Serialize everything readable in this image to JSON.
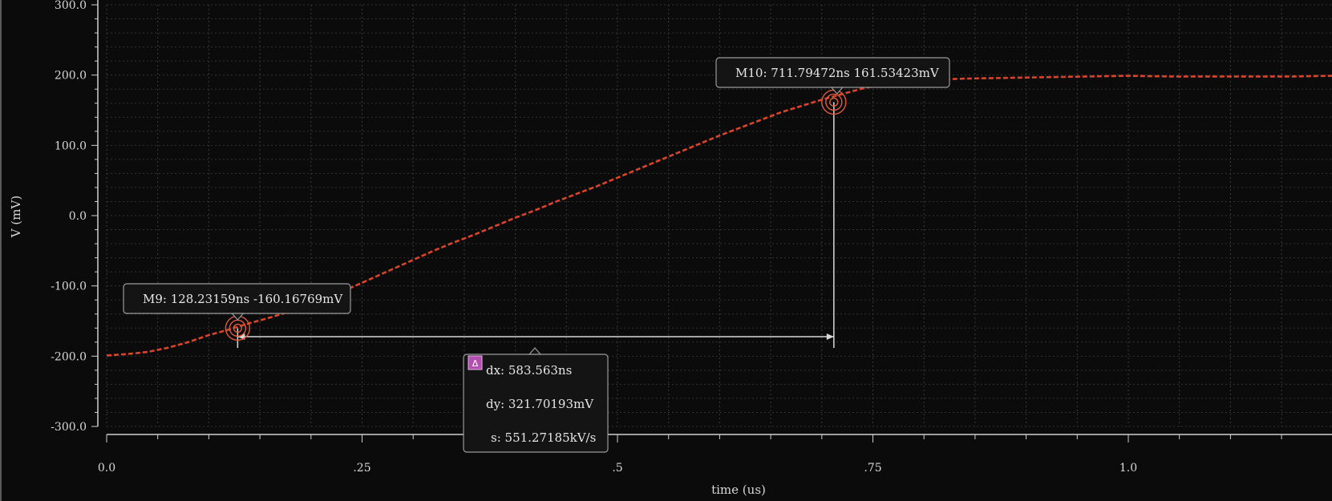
{
  "chart_data": {
    "type": "line",
    "xlabel": "time (us)",
    "ylabel": "V (mV)",
    "xlim": [
      0.0,
      1.2
    ],
    "ylim": [
      -300.0,
      300.0
    ],
    "x_ticks": [
      "0.0",
      ".25",
      ".5",
      ".75",
      "1.0"
    ],
    "x_tick_values": [
      0.0,
      0.25,
      0.5,
      0.75,
      1.0
    ],
    "y_ticks": [
      "300.0",
      "200.0",
      "100.0",
      "0.0",
      "-100.0",
      "-200.0",
      "-300.0"
    ],
    "y_tick_values": [
      300,
      200,
      100,
      0,
      -100,
      -200,
      -300
    ],
    "grid": true,
    "series": [
      {
        "color": "#d9442b",
        "style": "dashed",
        "x": [
          0.0,
          0.02,
          0.04,
          0.06,
          0.08,
          0.1,
          0.12,
          0.14,
          0.16,
          0.18,
          0.2,
          0.22,
          0.24,
          0.26,
          0.28,
          0.3,
          0.32,
          0.34,
          0.36,
          0.38,
          0.4,
          0.42,
          0.44,
          0.46,
          0.48,
          0.5,
          0.52,
          0.54,
          0.56,
          0.58,
          0.6,
          0.62,
          0.64,
          0.66,
          0.68,
          0.7,
          0.72,
          0.74,
          0.76,
          0.78,
          0.8,
          0.84,
          0.88,
          0.92,
          0.96,
          1.0,
          1.04,
          1.08,
          1.12,
          1.16,
          1.2
        ],
        "y": [
          -199,
          -197,
          -194,
          -188,
          -180,
          -170,
          -162,
          -153,
          -145,
          -136,
          -126,
          -114,
          -102,
          -89,
          -76,
          -63,
          -50,
          -38,
          -27,
          -15,
          -3,
          8,
          20,
          31,
          42,
          54,
          66,
          78,
          90,
          102,
          114,
          125,
          136,
          147,
          156,
          165,
          173,
          181,
          187,
          191,
          193,
          195,
          196,
          197,
          198,
          199,
          198,
          198,
          198,
          198,
          199
        ]
      }
    ],
    "markers": [
      {
        "name": "M9",
        "label": "M9: 128.23159ns -160.16769mV",
        "x": 0.12823159,
        "y": -160.16769
      },
      {
        "name": "M10",
        "label": "M10: 711.79472ns 161.53423mV",
        "x": 0.71179472,
        "y": 161.53423
      }
    ],
    "delta": {
      "icon": "delta-icon",
      "dx": "dx: 583.563ns",
      "dy": "dy: 321.70193mV",
      "s": "s: 551.27185kV/s"
    }
  }
}
